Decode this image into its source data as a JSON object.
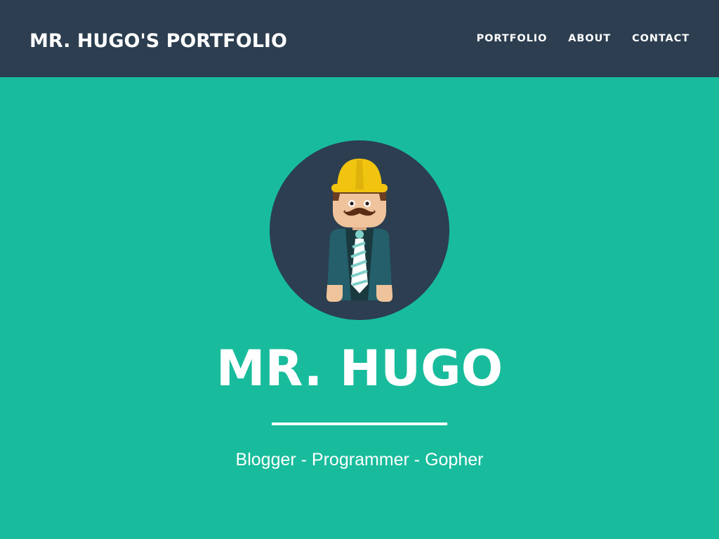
{
  "navbar": {
    "brand": "MR. HUGO'S PORTFOLIO",
    "links": [
      {
        "label": "PORTFOLIO"
      },
      {
        "label": "ABOUT"
      },
      {
        "label": "CONTACT"
      }
    ]
  },
  "hero": {
    "avatar_icon": "gopher-construction-worker-avatar",
    "name": "MR. HUGO",
    "tagline": "Blogger - Programmer - Gopher"
  },
  "colors": {
    "navbar_bg": "#2c3e50",
    "hero_bg": "#18bc9c",
    "text": "#ffffff",
    "helmet": "#f1c40f"
  }
}
